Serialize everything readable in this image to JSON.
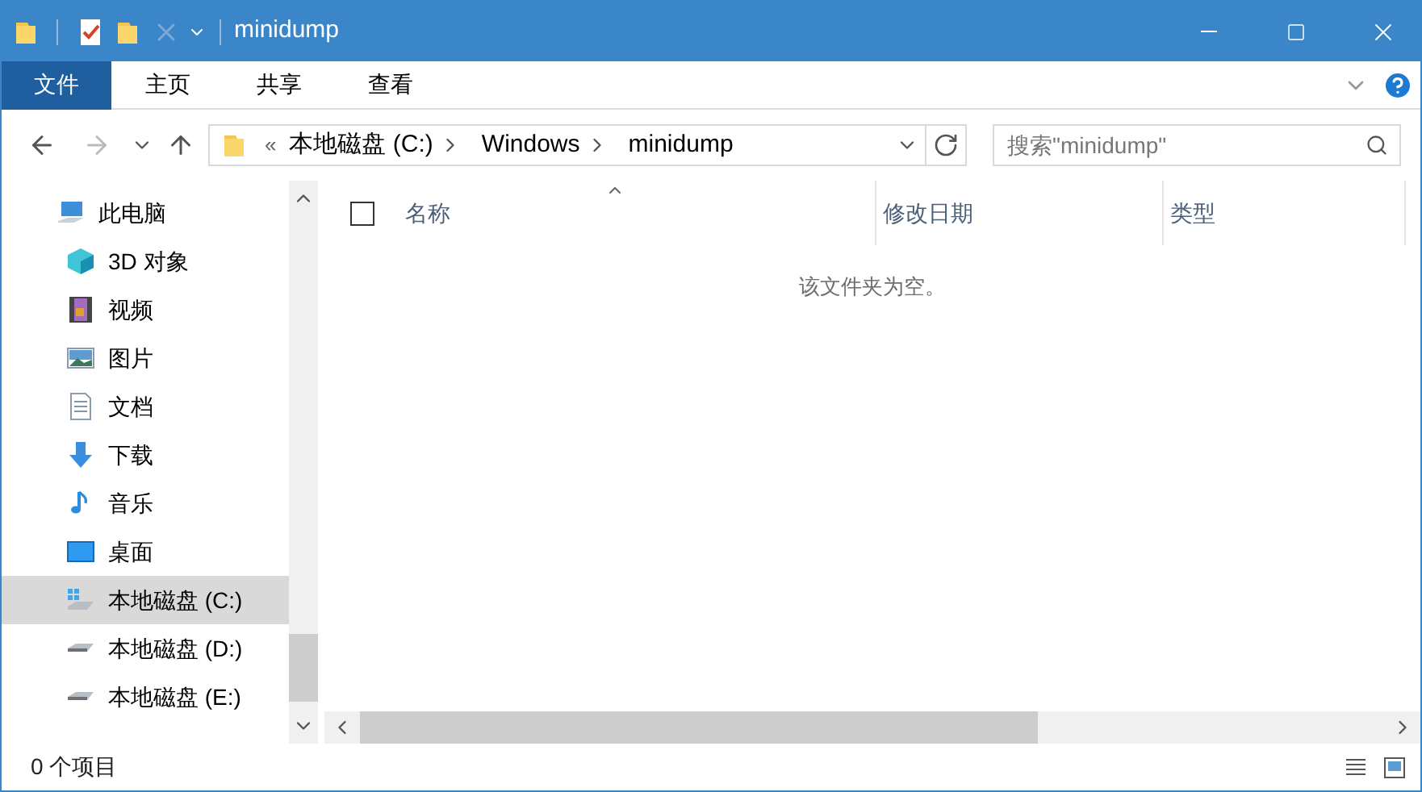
{
  "window": {
    "title": "minidump"
  },
  "ribbon_tabs": [
    {
      "label": "文件",
      "selected": true
    },
    {
      "label": "主页",
      "selected": false
    },
    {
      "label": "共享",
      "selected": false
    },
    {
      "label": "查看",
      "selected": false
    }
  ],
  "address": {
    "overflow": "«",
    "crumbs": [
      "本地磁盘 (C:)",
      "Windows",
      "minidump"
    ]
  },
  "search": {
    "placeholder": "搜索\"minidump\""
  },
  "sidebar": {
    "items": [
      {
        "label": "此电脑",
        "kind": "pc",
        "selected": false,
        "children": [
          {
            "label": "3D 对象",
            "kind": "cube",
            "selected": false
          },
          {
            "label": "视频",
            "kind": "video",
            "selected": false
          },
          {
            "label": "图片",
            "kind": "picture",
            "selected": false
          },
          {
            "label": "文档",
            "kind": "document",
            "selected": false
          },
          {
            "label": "下载",
            "kind": "download",
            "selected": false
          },
          {
            "label": "音乐",
            "kind": "music",
            "selected": false
          },
          {
            "label": "桌面",
            "kind": "desktop",
            "selected": false
          },
          {
            "label": "本地磁盘 (C:)",
            "kind": "system-drive",
            "selected": true
          },
          {
            "label": "本地磁盘 (D:)",
            "kind": "drive",
            "selected": false
          },
          {
            "label": "本地磁盘 (E:)",
            "kind": "drive",
            "selected": false
          }
        ]
      }
    ]
  },
  "table": {
    "select_all_checked": false,
    "columns": [
      {
        "label": "名称",
        "sorted": true
      },
      {
        "label": "修改日期",
        "sorted": false
      },
      {
        "label": "类型",
        "sorted": false
      }
    ],
    "empty_message": "该文件夹为空。"
  },
  "status_bar": {
    "count": "0 个项目"
  }
}
